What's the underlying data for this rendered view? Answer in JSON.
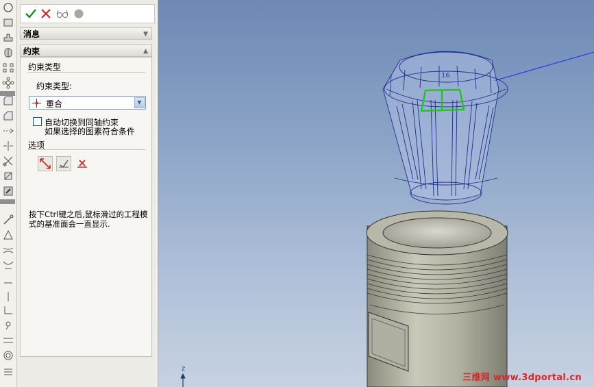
{
  "toolbar": {
    "icons": [
      "circle-icon",
      "rectangle-icon",
      "extrude-icon",
      "revolve-icon",
      "pattern-icon",
      "move-icon",
      "fillet-icon",
      "chamfer-icon",
      "dimension-icon",
      "split-icon",
      "trim-icon",
      "convert-icon",
      "scroll-icon",
      "sketch-line-icon",
      "plane-icon",
      "sweep-icon",
      "loft-icon",
      "line-icon",
      "vertical-line-icon",
      "corner-icon",
      "point-icon",
      "parallel-icon",
      "concentric-icon",
      "list-icon"
    ]
  },
  "panel": {
    "message_section": "消息",
    "constraint_section": "约束",
    "constraint_type_group": "约束类型",
    "constraint_type_label": "约束类型:",
    "constraint_type_value": "重合",
    "auto_switch_line1": "自动切换到同轴约束",
    "auto_switch_line2": "如果选择的图素符合条件",
    "options_group": "选项",
    "help_text": "按下Ctrl键之后,鼠标滑过的工程模式的基准面会一直显示."
  },
  "viewport": {
    "axis_label": "z",
    "watermark": "三维网 www.3dportal.cn",
    "dimension_label": "16",
    "colors": {
      "background_top": "#6d89b5",
      "selection": "#21c421",
      "model_body": "#b6b6a6",
      "transparent_part": "#b9c6e8"
    }
  }
}
